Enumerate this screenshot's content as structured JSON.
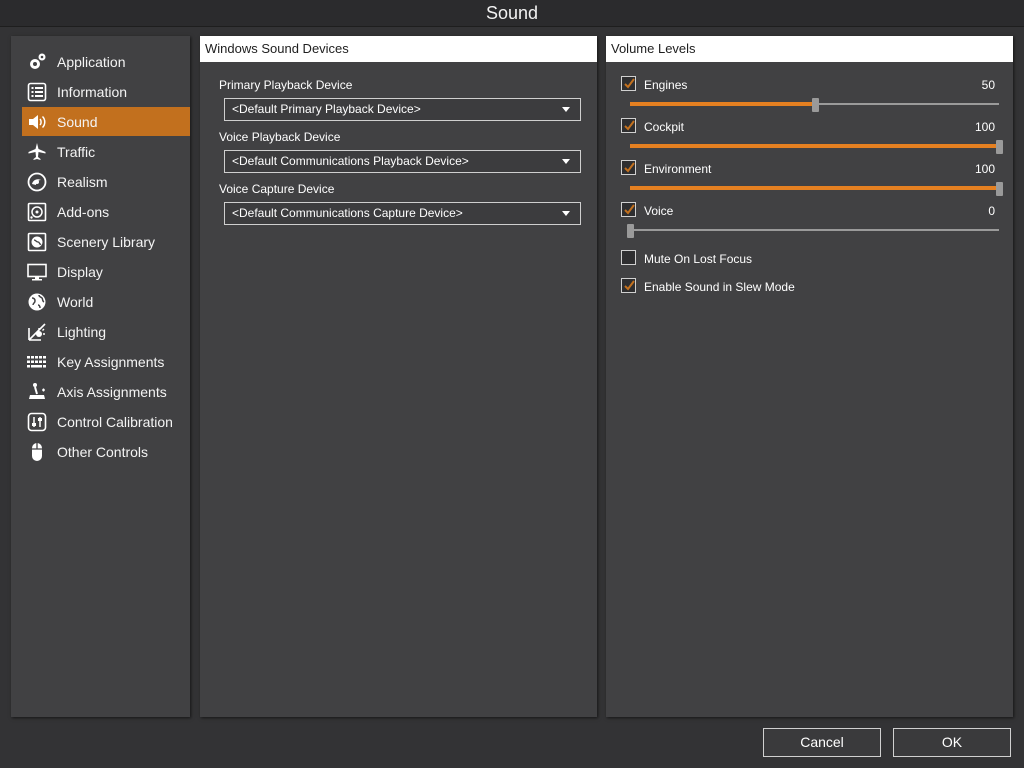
{
  "window": {
    "title": "Sound"
  },
  "sidebar": {
    "items": [
      {
        "label": "Application",
        "icon": "gears-icon",
        "active": false
      },
      {
        "label": "Information",
        "icon": "list-icon",
        "active": false
      },
      {
        "label": "Sound",
        "icon": "speaker-icon",
        "active": true
      },
      {
        "label": "Traffic",
        "icon": "airplane-icon",
        "active": false
      },
      {
        "label": "Realism",
        "icon": "realism-icon",
        "active": false
      },
      {
        "label": "Add-ons",
        "icon": "addons-icon",
        "active": false
      },
      {
        "label": "Scenery Library",
        "icon": "globe-scenery-icon",
        "active": false
      },
      {
        "label": "Display",
        "icon": "monitor-icon",
        "active": false
      },
      {
        "label": "World",
        "icon": "globe-icon",
        "active": false
      },
      {
        "label": "Lighting",
        "icon": "lighting-icon",
        "active": false
      },
      {
        "label": "Key Assignments",
        "icon": "keyboard-icon",
        "active": false
      },
      {
        "label": "Axis Assignments",
        "icon": "joystick-icon",
        "active": false
      },
      {
        "label": "Control Calibration",
        "icon": "calibration-icon",
        "active": false
      },
      {
        "label": "Other Controls",
        "icon": "mouse-icon",
        "active": false
      }
    ]
  },
  "devices_panel": {
    "title": "Windows Sound Devices",
    "primary_label": "Primary Playback Device",
    "primary_value": "<Default Primary Playback Device>",
    "voice_playback_label": "Voice Playback Device",
    "voice_playback_value": "<Default Communications Playback Device>",
    "voice_capture_label": "Voice Capture Device",
    "voice_capture_value": "<Default Communications Capture Device>"
  },
  "volume_panel": {
    "title": "Volume Levels",
    "engines": {
      "label": "Engines",
      "value": "50",
      "checked": true,
      "level": 0.5
    },
    "cockpit": {
      "label": "Cockpit",
      "value": "100",
      "checked": true,
      "level": 1.0
    },
    "environment": {
      "label": "Environment",
      "value": "100",
      "checked": true,
      "level": 1.0
    },
    "voice": {
      "label": "Voice",
      "value": "0",
      "checked": true,
      "level": 0.0
    },
    "mute_on_lost_focus": {
      "label": "Mute On Lost Focus",
      "checked": false
    },
    "enable_slew_sound": {
      "label": "Enable Sound in Slew Mode",
      "checked": true
    }
  },
  "footer": {
    "cancel_label": "Cancel",
    "ok_label": "OK"
  },
  "colors": {
    "accent": "#c2701e",
    "slider_fill": "#e58021",
    "panel": "#414143",
    "background": "#333335"
  }
}
